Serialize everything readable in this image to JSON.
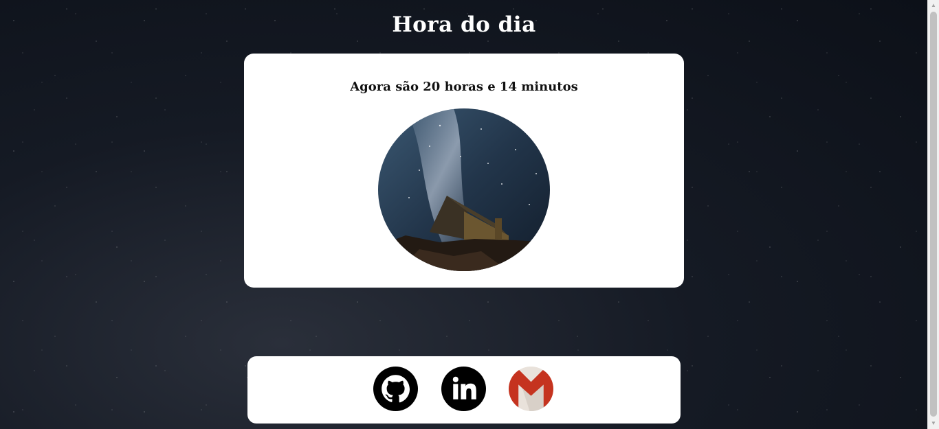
{
  "page": {
    "title": "Hora do dia"
  },
  "card": {
    "time_text": "Agora são 20 horas e 14 minutos",
    "image_icon": "night-church-photo"
  },
  "footer": {
    "links": [
      {
        "icon": "github-icon",
        "label": "GitHub"
      },
      {
        "icon": "linkedin-icon",
        "label": "LinkedIn"
      },
      {
        "icon": "gmail-icon",
        "label": "Gmail"
      }
    ]
  },
  "colors": {
    "background": "#151a24",
    "card": "#ffffff",
    "text_dark": "#111111",
    "title": "#ffffff",
    "gmail_red": "#c5331f"
  }
}
